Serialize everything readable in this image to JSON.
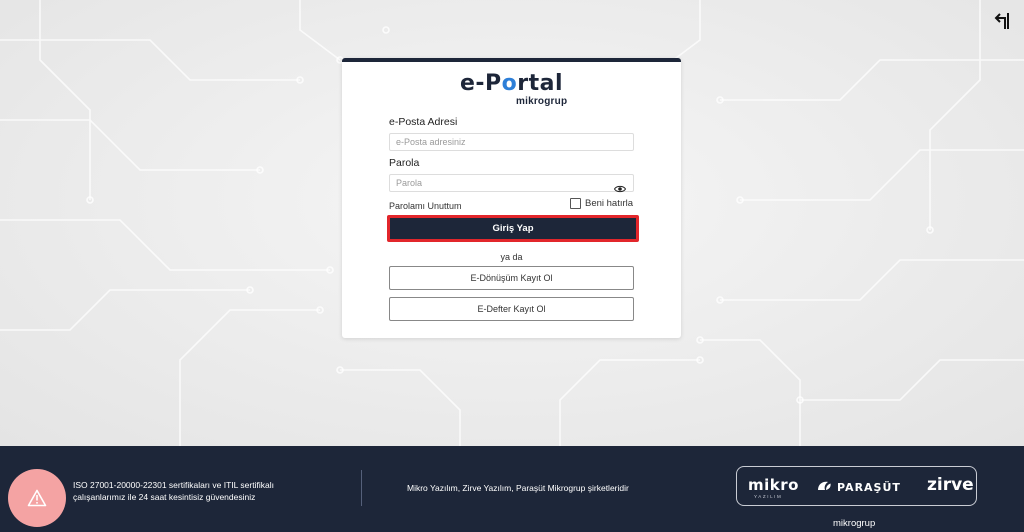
{
  "colors": {
    "primary": "#1d2639",
    "highlight": "#e2262b",
    "warning_bg": "#f4a3a3"
  },
  "logo": {
    "main_prefix": "e-P",
    "main_o": "o",
    "main_suffix": "rtal",
    "sub": "mikrogrup"
  },
  "form": {
    "email_label": "e-Posta Adresi",
    "email_placeholder": "e-Posta adresiniz",
    "email_value": "",
    "password_label": "Parola",
    "password_placeholder": "Parola",
    "password_value": "",
    "forgot_label": "Parolamı Unuttum",
    "remember_label": "Beni hatırla",
    "remember_checked": false,
    "login_label": "Giriş Yap",
    "or_label": "ya da",
    "edonusum_label": "E-Dönüşüm Kayıt Ol",
    "edefter_label": "E-Defter Kayıt Ol"
  },
  "icons": {
    "top_right": "turn-up-left-icon",
    "eye": "eye-icon",
    "warning": "warning-triangle-icon"
  },
  "footer": {
    "security_line1": "ISO 27001-20000-22301 sertifikaları ve ITIL sertifikalı",
    "security_line2": "çalışanlarımız ile 24 saat kesintisiz güvendesiniz",
    "companies_text": "Mikro Yazılım, Zirve Yazılım, Paraşüt Mikrogrup şirketleridir",
    "brand_mikro": "mikro",
    "brand_mikro_sub": "YAZILIM",
    "brand_parasut": "PARAŞÜT",
    "brand_zirve": "zirve",
    "brand_group": "mikrogrup"
  }
}
